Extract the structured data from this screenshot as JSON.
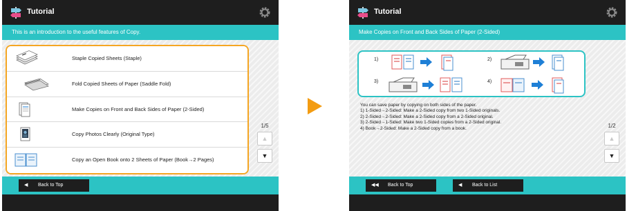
{
  "colors": {
    "accent": "#2cc3c4",
    "highlight": "#f5a623",
    "dark": "#1e1e1e",
    "arrow": "#1e7fd6",
    "forward_arrow": "#f39c12"
  },
  "left_screen": {
    "title": "Tutorial",
    "info": "This is an introduction to the useful features of Copy.",
    "items": [
      {
        "icon": "staple-icon",
        "label": "Staple Copied Sheets (Staple)"
      },
      {
        "icon": "saddle-fold-icon",
        "label": "Fold Copied Sheets of Paper (Saddle Fold)"
      },
      {
        "icon": "two-sided-icon",
        "label": "Make Copies on Front and Back Sides of Paper (2-Sided)"
      },
      {
        "icon": "photo-icon",
        "label": "Copy Photos Clearly (Original Type)"
      },
      {
        "icon": "book-icon",
        "label": "Copy an Open Book onto 2 Sheets of Paper (Book→2 Pages)"
      }
    ],
    "page_count": "1/5",
    "back_to_top": "Back to Top"
  },
  "right_screen": {
    "title": "Tutorial",
    "info": "Make Copies on Front and Back Sides of Paper (2-Sided)",
    "diagram_numbers": [
      "1)",
      "2)",
      "3)",
      "4)"
    ],
    "description_lines": [
      "You can save paper by copying on both sides of the paper.",
      "1) 1-Sided→2-Sided: Make a 2-Sided copy from two 1-Sided originals.",
      "2) 2-Sided→2-Sided: Make a 2-Sided copy from a 2-Sided original.",
      "3) 2-Sided→1-Sided: Make two 1-Sided copies from a 2-Sided original.",
      "4) Book→2-Sided:  Make a 2-Sided copy from a book."
    ],
    "page_count": "1/2",
    "back_to_top": "Back to Top",
    "back_to_list": "Back to List"
  },
  "icons": {
    "app": "tutorial-signpost-icon",
    "settings": "gear-icon",
    "next": "forward-arrow-icon"
  }
}
